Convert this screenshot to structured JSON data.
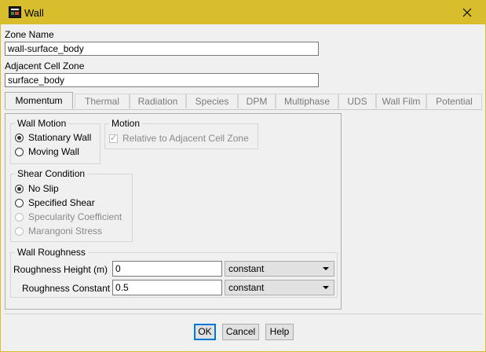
{
  "window": {
    "title": "Wall"
  },
  "zone_name": {
    "label": "Zone Name",
    "value": "wall-surface_body"
  },
  "adjacent": {
    "label": "Adjacent Cell Zone",
    "value": "surface_body"
  },
  "tabs": [
    {
      "label": "Momentum"
    },
    {
      "label": "Thermal"
    },
    {
      "label": "Radiation"
    },
    {
      "label": "Species"
    },
    {
      "label": "DPM"
    },
    {
      "label": "Multiphase"
    },
    {
      "label": "UDS"
    },
    {
      "label": "Wall Film"
    },
    {
      "label": "Potential"
    }
  ],
  "wall_motion": {
    "title": "Wall Motion",
    "options": [
      {
        "label": "Stationary Wall"
      },
      {
        "label": "Moving Wall"
      }
    ]
  },
  "motion": {
    "title": "Motion",
    "relative_label": "Relative to Adjacent Cell Zone"
  },
  "shear": {
    "title": "Shear Condition",
    "options": [
      {
        "label": "No Slip"
      },
      {
        "label": "Specified Shear"
      },
      {
        "label": "Specularity Coefficient"
      },
      {
        "label": "Marangoni Stress"
      }
    ]
  },
  "roughness": {
    "title": "Wall Roughness",
    "height_label": "Roughness Height (m)",
    "height_value": "0",
    "height_method": "constant",
    "constant_label": "Roughness Constant",
    "constant_value": "0.5",
    "constant_method": "constant"
  },
  "buttons": {
    "ok": "OK",
    "cancel": "Cancel",
    "help": "Help"
  },
  "colors": {
    "titlebar": "#d8bd2c",
    "focus": "#0078d7"
  }
}
